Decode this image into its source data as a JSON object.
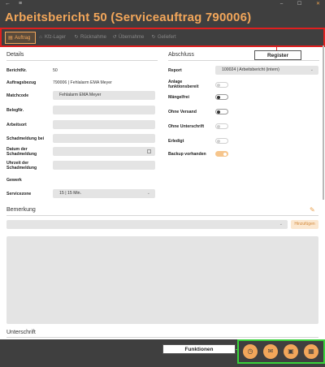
{
  "window": {
    "back_glyph": "←",
    "menu_glyph": "≡",
    "minimize_glyph": "–",
    "maximize_glyph": "☐",
    "close_glyph": "✕"
  },
  "header": {
    "title": "Arbeitsbericht 50 (Serviceauftrag 790006)"
  },
  "tabs": [
    {
      "label": "Auftrag",
      "icon": "list-icon",
      "glyph": "▤",
      "active": true
    },
    {
      "label": "Kfz-Lager",
      "icon": "warehouse-icon",
      "glyph": "⌂",
      "active": false
    },
    {
      "label": "Rücknahme",
      "icon": "return-icon",
      "glyph": "↻",
      "active": false
    },
    {
      "label": "Übernahme",
      "icon": "transfer-icon",
      "glyph": "↺",
      "active": false
    },
    {
      "label": "Geliefert",
      "icon": "delivered-icon",
      "glyph": "↻",
      "active": false
    }
  ],
  "callouts": {
    "register": "Register",
    "funktionen": "Funktionen"
  },
  "details": {
    "heading": "Details",
    "berichtnr_label": "BerichtNr.",
    "berichtnr_value": "50",
    "auftragsbezug_label": "Auftragsbezug",
    "auftragsbezug_value": "790006  |  Fehlalarm EMA Meyer",
    "matchcode_label": "Matchcode",
    "matchcode_value": "Fehlalarm EMA Meyer",
    "belegnr_label": "BelegNr.",
    "arbeitsort_label": "Arbeitsort",
    "schadmeldung_bei_label": "Schadmeldung bei",
    "datum_label": "Datum der Schadmeldung",
    "uhrzeit_label": "Uhrzeit der Schadmeldung",
    "gewerk_label": "Gewerk",
    "servicezone_label": "Servicezone",
    "servicezone_value": "15  |  15 Min."
  },
  "abschluss": {
    "heading": "Abschluss",
    "report_label": "Report",
    "report_value": "100024  |  Arbeitsbericht (intern)",
    "toggles": [
      {
        "label": "Anlage funktionsbereit",
        "state": "disabled"
      },
      {
        "label": "Mängelfrei",
        "state": "off"
      },
      {
        "label": "Ohne Versand",
        "state": "off"
      },
      {
        "label": "Ohne Unterschrift",
        "state": "disabled"
      },
      {
        "label": "Erledigt",
        "state": "disabled"
      },
      {
        "label": "Backup vorhanden",
        "state": "on"
      }
    ]
  },
  "bemerkung": {
    "heading": "Bemerkung",
    "add_label": "Hinzufügen",
    "edit_glyph": "✎"
  },
  "unterschrift": {
    "heading": "Unterschrift"
  },
  "functions": [
    {
      "name": "timer-icon",
      "glyph": "◷"
    },
    {
      "name": "send-mail-icon",
      "glyph": "✉"
    },
    {
      "name": "clipboard-icon",
      "glyph": "▣"
    },
    {
      "name": "save-icon",
      "glyph": "▦"
    }
  ],
  "colors": {
    "accent": "#f2a65a",
    "chrome": "#3f3f3f",
    "register_highlight": "#e01f1f",
    "functions_highlight": "#38d23a"
  }
}
